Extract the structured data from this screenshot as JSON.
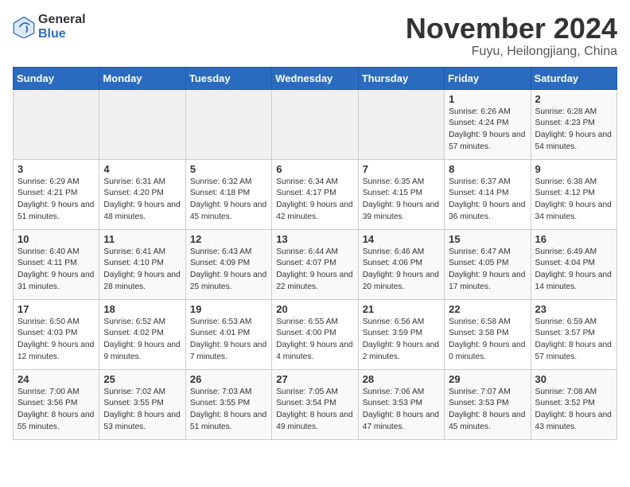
{
  "logo": {
    "general": "General",
    "blue": "Blue"
  },
  "title": "November 2024",
  "subtitle": "Fuyu, Heilongjiang, China",
  "days_header": [
    "Sunday",
    "Monday",
    "Tuesday",
    "Wednesday",
    "Thursday",
    "Friday",
    "Saturday"
  ],
  "weeks": [
    [
      {
        "day": "",
        "info": ""
      },
      {
        "day": "",
        "info": ""
      },
      {
        "day": "",
        "info": ""
      },
      {
        "day": "",
        "info": ""
      },
      {
        "day": "",
        "info": ""
      },
      {
        "day": "1",
        "info": "Sunrise: 6:26 AM\nSunset: 4:24 PM\nDaylight: 9 hours and 57 minutes."
      },
      {
        "day": "2",
        "info": "Sunrise: 6:28 AM\nSunset: 4:23 PM\nDaylight: 9 hours and 54 minutes."
      }
    ],
    [
      {
        "day": "3",
        "info": "Sunrise: 6:29 AM\nSunset: 4:21 PM\nDaylight: 9 hours and 51 minutes."
      },
      {
        "day": "4",
        "info": "Sunrise: 6:31 AM\nSunset: 4:20 PM\nDaylight: 9 hours and 48 minutes."
      },
      {
        "day": "5",
        "info": "Sunrise: 6:32 AM\nSunset: 4:18 PM\nDaylight: 9 hours and 45 minutes."
      },
      {
        "day": "6",
        "info": "Sunrise: 6:34 AM\nSunset: 4:17 PM\nDaylight: 9 hours and 42 minutes."
      },
      {
        "day": "7",
        "info": "Sunrise: 6:35 AM\nSunset: 4:15 PM\nDaylight: 9 hours and 39 minutes."
      },
      {
        "day": "8",
        "info": "Sunrise: 6:37 AM\nSunset: 4:14 PM\nDaylight: 9 hours and 36 minutes."
      },
      {
        "day": "9",
        "info": "Sunrise: 6:38 AM\nSunset: 4:12 PM\nDaylight: 9 hours and 34 minutes."
      }
    ],
    [
      {
        "day": "10",
        "info": "Sunrise: 6:40 AM\nSunset: 4:11 PM\nDaylight: 9 hours and 31 minutes."
      },
      {
        "day": "11",
        "info": "Sunrise: 6:41 AM\nSunset: 4:10 PM\nDaylight: 9 hours and 28 minutes."
      },
      {
        "day": "12",
        "info": "Sunrise: 6:43 AM\nSunset: 4:09 PM\nDaylight: 9 hours and 25 minutes."
      },
      {
        "day": "13",
        "info": "Sunrise: 6:44 AM\nSunset: 4:07 PM\nDaylight: 9 hours and 22 minutes."
      },
      {
        "day": "14",
        "info": "Sunrise: 6:46 AM\nSunset: 4:06 PM\nDaylight: 9 hours and 20 minutes."
      },
      {
        "day": "15",
        "info": "Sunrise: 6:47 AM\nSunset: 4:05 PM\nDaylight: 9 hours and 17 minutes."
      },
      {
        "day": "16",
        "info": "Sunrise: 6:49 AM\nSunset: 4:04 PM\nDaylight: 9 hours and 14 minutes."
      }
    ],
    [
      {
        "day": "17",
        "info": "Sunrise: 6:50 AM\nSunset: 4:03 PM\nDaylight: 9 hours and 12 minutes."
      },
      {
        "day": "18",
        "info": "Sunrise: 6:52 AM\nSunset: 4:02 PM\nDaylight: 9 hours and 9 minutes."
      },
      {
        "day": "19",
        "info": "Sunrise: 6:53 AM\nSunset: 4:01 PM\nDaylight: 9 hours and 7 minutes."
      },
      {
        "day": "20",
        "info": "Sunrise: 6:55 AM\nSunset: 4:00 PM\nDaylight: 9 hours and 4 minutes."
      },
      {
        "day": "21",
        "info": "Sunrise: 6:56 AM\nSunset: 3:59 PM\nDaylight: 9 hours and 2 minutes."
      },
      {
        "day": "22",
        "info": "Sunrise: 6:58 AM\nSunset: 3:58 PM\nDaylight: 9 hours and 0 minutes."
      },
      {
        "day": "23",
        "info": "Sunrise: 6:59 AM\nSunset: 3:57 PM\nDaylight: 8 hours and 57 minutes."
      }
    ],
    [
      {
        "day": "24",
        "info": "Sunrise: 7:00 AM\nSunset: 3:56 PM\nDaylight: 8 hours and 55 minutes."
      },
      {
        "day": "25",
        "info": "Sunrise: 7:02 AM\nSunset: 3:55 PM\nDaylight: 8 hours and 53 minutes."
      },
      {
        "day": "26",
        "info": "Sunrise: 7:03 AM\nSunset: 3:55 PM\nDaylight: 8 hours and 51 minutes."
      },
      {
        "day": "27",
        "info": "Sunrise: 7:05 AM\nSunset: 3:54 PM\nDaylight: 8 hours and 49 minutes."
      },
      {
        "day": "28",
        "info": "Sunrise: 7:06 AM\nSunset: 3:53 PM\nDaylight: 8 hours and 47 minutes."
      },
      {
        "day": "29",
        "info": "Sunrise: 7:07 AM\nSunset: 3:53 PM\nDaylight: 8 hours and 45 minutes."
      },
      {
        "day": "30",
        "info": "Sunrise: 7:08 AM\nSunset: 3:52 PM\nDaylight: 8 hours and 43 minutes."
      }
    ]
  ]
}
